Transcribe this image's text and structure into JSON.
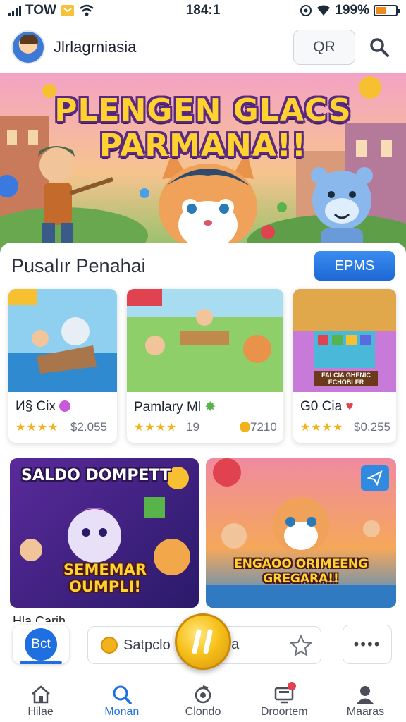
{
  "status_bar": {
    "carrier": "TOW",
    "time": "184:1",
    "battery": "199%",
    "battery_level_percent": 55
  },
  "header": {
    "app_name": "Jlrlagrniasia",
    "qr_label": "QR",
    "search_icon": "search-icon"
  },
  "hero": {
    "title_line1": "PLENGEN GLACS",
    "title_line2": "PARMANA!!"
  },
  "section": {
    "title": "Pusalır Penahai",
    "button_label": "EPMS"
  },
  "games": [
    {
      "name": "И§ Cix",
      "rating_stars": 4,
      "meta": "$2.055",
      "badge_icon": "gem-icon",
      "badge_color": "#c75ad8"
    },
    {
      "name": "Pamlary Ml",
      "rating_stars": 4,
      "meta_left": "19",
      "meta": "7210",
      "badge_icon": "sparkle-icon",
      "badge_color": "#58b34a"
    },
    {
      "name": "G0 Cia",
      "rating_stars": 4,
      "meta": "$0.255",
      "badge_icon": "heart-icon",
      "badge_color": "#e0424f"
    }
  ],
  "game3_banner_text": "FALCIA GHENIC ECHOBLER",
  "promos": [
    {
      "title": "SALDO DOMPETT",
      "subtitle_line1": "SEMEMAR",
      "subtitle_line2": "OUMPLI!"
    },
    {
      "subtitle_line1": "ENGAOO ORIMEENG",
      "subtitle_line2": "GREGARA!!"
    }
  ],
  "partial_label": "Hla Carih",
  "action_bar": {
    "bct_label": "Bct",
    "wallet_text_left": "Satpclo",
    "wallet_text_right": "ira"
  },
  "bottom_nav": [
    {
      "label": "Hilae",
      "icon": "home-icon",
      "active": false
    },
    {
      "label": "Monan",
      "icon": "search-icon",
      "active": true
    },
    {
      "label": "Clondo",
      "icon": "refresh-icon",
      "active": false
    },
    {
      "label": "Droortem",
      "icon": "screen-icon",
      "active": false
    },
    {
      "label": "Maaras",
      "icon": "profile-icon",
      "active": false
    }
  ],
  "colors": {
    "accent": "#1f6fe0",
    "star": "#f2b21c",
    "battery": "#f08a1c",
    "hero_title": "#ffd230"
  }
}
